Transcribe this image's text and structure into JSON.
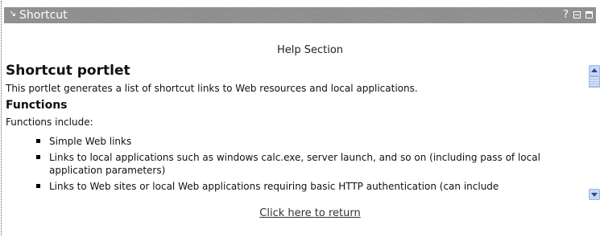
{
  "portlet": {
    "title": "Shortcut",
    "help_label": "?",
    "icons": {
      "menu": "menu-arrow-icon",
      "help": "help-icon",
      "minimize": "minimize-icon",
      "maximize": "maximize-icon"
    }
  },
  "help": {
    "section_heading": "Help Section",
    "title": "Shortcut portlet",
    "description": "This portlet generates a list of shortcut links to Web resources and local applications.",
    "functions_heading": "Functions",
    "functions_intro": "Functions include:",
    "functions": [
      "Simple Web links",
      "Links to local applications such as windows calc.exe, server launch, and so on (including pass of local application parameters)",
      "Links to Web sites or local Web applications requiring basic HTTP authentication (can include"
    ],
    "return_link": "Click here to return"
  },
  "colors": {
    "titlebar": "#8c8c8c",
    "scrollbar": "#c7d7f5"
  }
}
